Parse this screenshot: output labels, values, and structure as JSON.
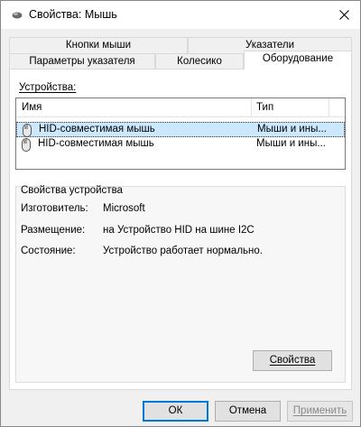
{
  "window": {
    "title": "Свойства: Мышь",
    "close_icon": "close-icon"
  },
  "tabs": {
    "row_back": [
      {
        "label": "Кнопки мыши"
      },
      {
        "label": "Указатели"
      }
    ],
    "row_front": [
      {
        "label": "Параметры указателя"
      },
      {
        "label": "Колесико"
      },
      {
        "label": "Оборудование",
        "active": true
      }
    ]
  },
  "devices": {
    "label": "Устройства:",
    "columns": [
      "Имя",
      "Тип"
    ],
    "rows": [
      {
        "name": "HID-совместимая мышь",
        "type": "Мыши и ины...",
        "selected": true,
        "icon": "mouse-icon"
      },
      {
        "name": "HID-совместимая мышь",
        "type": "Мыши и ины...",
        "selected": false,
        "icon": "mouse-icon"
      }
    ]
  },
  "properties": {
    "label": "Свойства устройства",
    "manufacturer_label": "Изготовитель:",
    "manufacturer_value": "Microsoft",
    "location_label": "Размещение:",
    "location_value": "на Устройство HID на шине I2C",
    "status_label": "Состояние:",
    "status_value": "Устройство работает нормально.",
    "properties_button": "Свойства"
  },
  "footer": {
    "ok": "ОК",
    "cancel": "Отмена",
    "apply": "Применить"
  },
  "colors": {
    "selection": "#cce8ff",
    "default_button_border": "#0078d7"
  }
}
